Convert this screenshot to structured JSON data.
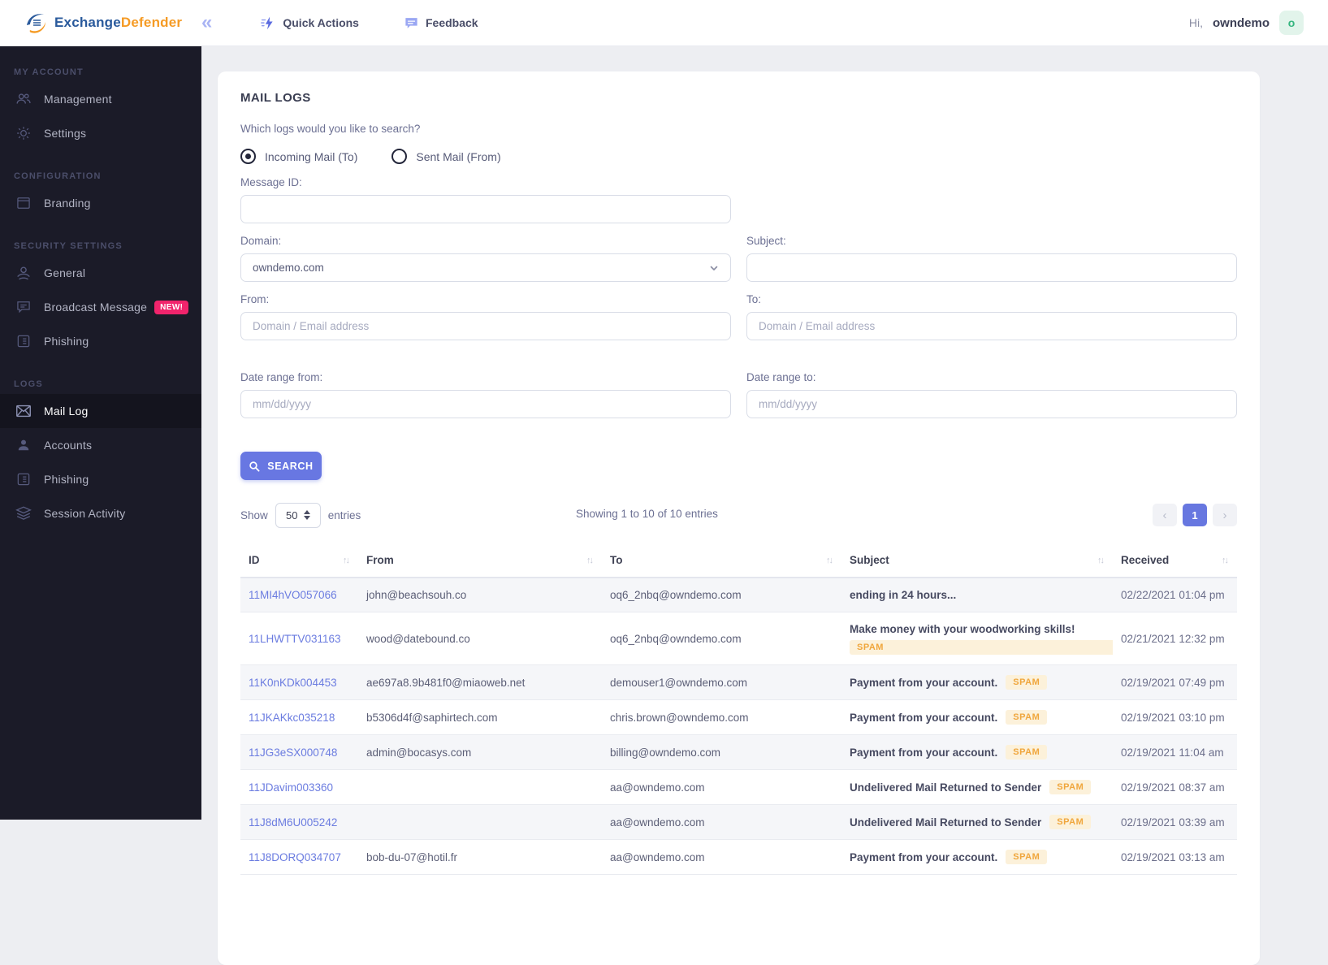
{
  "header": {
    "brand_primary": "Exchange",
    "brand_secondary": "Defender",
    "quick_actions_label": "Quick Actions",
    "feedback_label": "Feedback",
    "greeting": "Hi,",
    "username": "owndemo",
    "user_badge": "o"
  },
  "icons": {
    "collapse": "«",
    "prev": "‹",
    "next": "›",
    "sort": "↑↓"
  },
  "sidebar": {
    "sections": [
      {
        "title": "MY ACCOUNT",
        "items": [
          {
            "label": "Management"
          },
          {
            "label": "Settings"
          }
        ]
      },
      {
        "title": "CONFIGURATION",
        "items": [
          {
            "label": "Branding"
          }
        ]
      },
      {
        "title": "SECURITY SETTINGS",
        "items": [
          {
            "label": "General"
          },
          {
            "label": "Broadcast Message",
            "badge": "NEW!"
          },
          {
            "label": "Phishing"
          }
        ]
      },
      {
        "title": "LOGS",
        "items": [
          {
            "label": "Mail Log",
            "active": true
          },
          {
            "label": "Accounts"
          },
          {
            "label": "Phishing"
          },
          {
            "label": "Session Activity"
          }
        ]
      }
    ]
  },
  "main": {
    "title": "MAIL LOGS",
    "question": "Which logs would you like to search?",
    "radios": [
      {
        "label": "Incoming Mail (To)",
        "selected": true
      },
      {
        "label": "Sent Mail (From)",
        "selected": false
      }
    ],
    "fields": {
      "message_id_label": "Message ID:",
      "domain_label": "Domain:",
      "domain_value": "owndemo.com",
      "subject_label": "Subject:",
      "from_label": "From:",
      "from_placeholder": "Domain / Email address",
      "to_label": "To:",
      "to_placeholder": "Domain / Email address",
      "date_from_label": "Date range from:",
      "date_to_label": "Date range to:",
      "date_placeholder": "mm/dd/yyyy"
    },
    "search_button_label": "SEARCH",
    "list_controls": {
      "show_label": "Show",
      "page_size": "50",
      "entries_label": "entries",
      "info": "Showing 1 to 10 of 10 entries",
      "current_page": "1"
    }
  },
  "table": {
    "columns": [
      "ID",
      "From",
      "To",
      "Subject",
      "Received"
    ],
    "spam_label": "SPAM",
    "rows": [
      {
        "id": "11MI4hVO057066",
        "from": "john@beachsouh.co",
        "to": "oq6_2nbq@owndemo.com",
        "subject": "ending in 24 hours...",
        "spam": "none",
        "received": "02/22/2021 01:04 pm"
      },
      {
        "id": "11LHWTTV031163",
        "from": "wood@datebound.co",
        "to": "oq6_2nbq@owndemo.com",
        "subject": "Make money with your woodworking skills!",
        "spam": "below",
        "received": "02/21/2021 12:32 pm"
      },
      {
        "id": "11K0nKDk004453",
        "from": "ae697a8.9b481f0@miaoweb.net",
        "to": "demouser1@owndemo.com",
        "subject": "Payment from your account.",
        "spam": "inline",
        "received": "02/19/2021 07:49 pm"
      },
      {
        "id": "11JKAKkc035218",
        "from": "b5306d4f@saphirtech.com",
        "to": "chris.brown@owndemo.com",
        "subject": "Payment from your account.",
        "spam": "inline",
        "received": "02/19/2021 03:10 pm"
      },
      {
        "id": "11JG3eSX000748",
        "from": "admin@bocasys.com",
        "to": "billing@owndemo.com",
        "subject": "Payment from your account.",
        "spam": "inline",
        "received": "02/19/2021 11:04 am"
      },
      {
        "id": "11JDavim003360",
        "from": "",
        "to": "aa@owndemo.com",
        "subject": "Undelivered Mail Returned to Sender",
        "spam": "inline",
        "received": "02/19/2021 08:37 am"
      },
      {
        "id": "11J8dM6U005242",
        "from": "",
        "to": "aa@owndemo.com",
        "subject": "Undelivered Mail Returned to Sender",
        "spam": "inline",
        "received": "02/19/2021 03:39 am"
      },
      {
        "id": "11J8DORQ034707",
        "from": "bob-du-07@hotil.fr",
        "to": "aa@owndemo.com",
        "subject": "Payment from your account.",
        "spam": "inline",
        "received": "02/19/2021 03:13 am"
      }
    ]
  },
  "colors": {
    "accent": "#6777e0",
    "sidebar_bg": "#1b1b28",
    "spam_bg": "#fcf1da",
    "spam_text": "#f0a63c",
    "new_badge": "#f1246c",
    "link": "#6b7ce0",
    "user_badge_bg": "#e2f4eb",
    "user_badge_text": "#35b57f",
    "brand_blue": "#2a5a9c",
    "brand_orange": "#f59b25"
  }
}
